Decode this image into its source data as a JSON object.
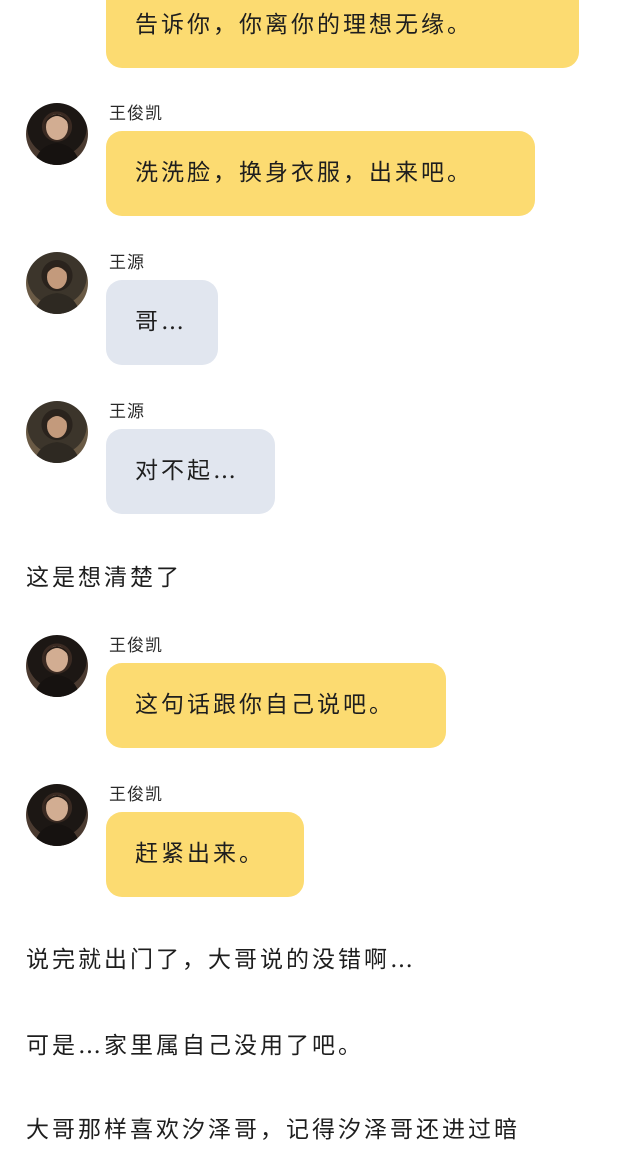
{
  "messages": [
    {
      "text": "告诉你，你离你的理想无缘。"
    },
    {
      "sender": "王俊凯",
      "text": "洗洗脸，换身衣服，出来吧。"
    },
    {
      "sender": "王源",
      "text": "哥…"
    },
    {
      "sender": "王源",
      "text": "对不起…"
    },
    {
      "sender": "王俊凯",
      "text": "这句话跟你自己说吧。"
    },
    {
      "sender": "王俊凯",
      "text": "赶紧出来。"
    }
  ],
  "narration": [
    "这是想清楚了",
    "说完就出门了，大哥说的没错啊…",
    "可是…家里属自己没用了吧。",
    "大哥那样喜欢汐泽哥，记得汐泽哥还进过暗"
  ],
  "colors": {
    "wang_junkai_bubble": "#fcdb71",
    "wang_yuan_bubble": "#e1e6ef"
  }
}
